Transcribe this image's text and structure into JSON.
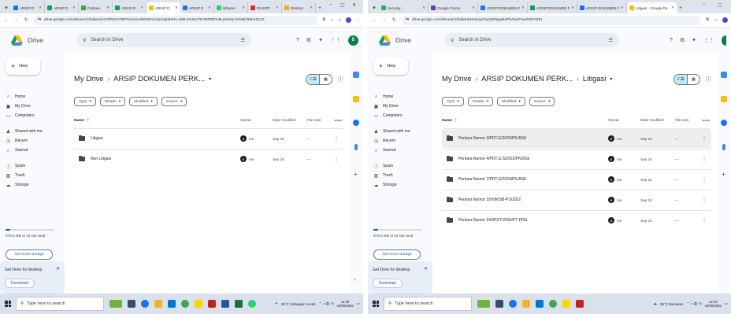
{
  "colors": {
    "drive_blue": "#0b57d0",
    "sidebar_bg": "#f8fafd",
    "selected_row": "#eeeeee",
    "toggle_active": "#c2e7ff",
    "taskbar_bg": "#dbe1ec"
  },
  "drive": {
    "app_name": "Drive",
    "search_placeholder": "Search in Drive",
    "new_label": "New",
    "nav": {
      "home": "Home",
      "my_drive": "My Drive",
      "computers": "Computers",
      "shared": "Shared with me",
      "recent": "Recent",
      "starred": "Starred",
      "spam": "Spam",
      "trash": "Trash",
      "storage": "Storage"
    },
    "storage_used": "976.5 MB of 15 GB used",
    "get_storage": "Get more storage",
    "promo_title": "Get Drive for desktop",
    "promo_download": "Download",
    "filters": {
      "type": "Type",
      "people": "People",
      "modified": "Modified",
      "source": "Source"
    },
    "columns": {
      "name": "Name",
      "owner": "Owner",
      "date_modified": "Date modified",
      "file_size": "File size"
    }
  },
  "left": {
    "tabs": [
      {
        "label": "ARSIP D",
        "fav": "#1a73e8"
      },
      {
        "label": "ARSIP D",
        "fav": "#0f9d58"
      },
      {
        "label": "Perkara",
        "fav": "#34a853"
      },
      {
        "label": "ARSIP D",
        "fav": "#0f9d58"
      },
      {
        "label": "ARSIP D",
        "fav": "#fbbc04",
        "active": true
      },
      {
        "label": "ARSIP D",
        "fav": "#1a73e8"
      },
      {
        "label": "WhatsA",
        "fav": "#25d366"
      },
      {
        "label": "PKSIPP",
        "fav": "#d93025"
      },
      {
        "label": "Direktor",
        "fav": "#f9ab00"
      }
    ],
    "url": "drive.google.com/drive/u/1/folders/1S7bhOcYNtPCmvOAdSNsPsCrqLbq1B2H1-zSB-Ox4ecTKOEPBZ%5Ly2%5L2YoWj7IMHHCC2",
    "breadcrumb": {
      "root": "My Drive",
      "folder": "ARSIP DOKUMEN PERK..."
    },
    "rows": [
      {
        "name": "Litigasi",
        "owner": "me",
        "owner_initial": "B",
        "date": "Sep 18",
        "size": "—"
      },
      {
        "name": "Non Litigasi",
        "owner": "me",
        "owner_initial": "B",
        "date": "Sep 18",
        "size": "—"
      }
    ],
    "taskbar": {
      "search_placeholder": "Type here to search",
      "weather": "29°C Sebagian cerah",
      "time": "11:28",
      "date": "19/09/2025"
    }
  },
  "right": {
    "tabs": [
      {
        "label": "Security",
        "fav": "#34a853"
      },
      {
        "label": "Google Forms",
        "fav": "#673ab7"
      },
      {
        "label": "ARSIP DOKUMEN PE",
        "fav": "#1a73e8"
      },
      {
        "label": "ARSIP DOKUMEN PE",
        "fav": "#0f9d58"
      },
      {
        "label": "ARSIP DOKUMEN PE",
        "fav": "#1a73e8"
      },
      {
        "label": "Litigasi - Google Dri",
        "fav": "#fbbc04",
        "active": true
      }
    ],
    "url": "drive.google.com/drive/u/1/folders/1HaAgYDyQzRqayBsPhAKeFzyKhWYIZSI",
    "breadcrumb": {
      "root": "My Drive",
      "parent": "ARSIP DOKUMEN PERK...",
      "folder": "Litigasi"
    },
    "rows": [
      {
        "name": "Perkara Nomor 3/PDT.G/2025/PN BSK",
        "owner": "me",
        "owner_initial": "B",
        "date": "Sep 18",
        "size": "—",
        "selected": true
      },
      {
        "name": "Perkara Nomor 4/PDT.G.S/2022/PN.BSk",
        "owner": "me",
        "owner_initial": "B",
        "date": "Sep 18",
        "size": "—"
      },
      {
        "name": "Perkara Nomor 7/PDT.G/2024/PN.BSK",
        "owner": "me",
        "owner_initial": "B",
        "date": "Sep 18",
        "size": "—"
      },
      {
        "name": "Perkara Nomor 18/VIKISB-PS/2022",
        "owner": "me",
        "owner_initial": "B",
        "date": "Sep 18",
        "size": "—"
      },
      {
        "name": "Perkara Nomor 243/PDT/2024/PT PDG",
        "owner": "me",
        "owner_initial": "B",
        "date": "Sep 18",
        "size": "—"
      }
    ],
    "taskbar": {
      "search_placeholder": "Type here to search",
      "weather": "29°C Berawan",
      "time": "16:23",
      "date": "19/09/2025"
    }
  }
}
